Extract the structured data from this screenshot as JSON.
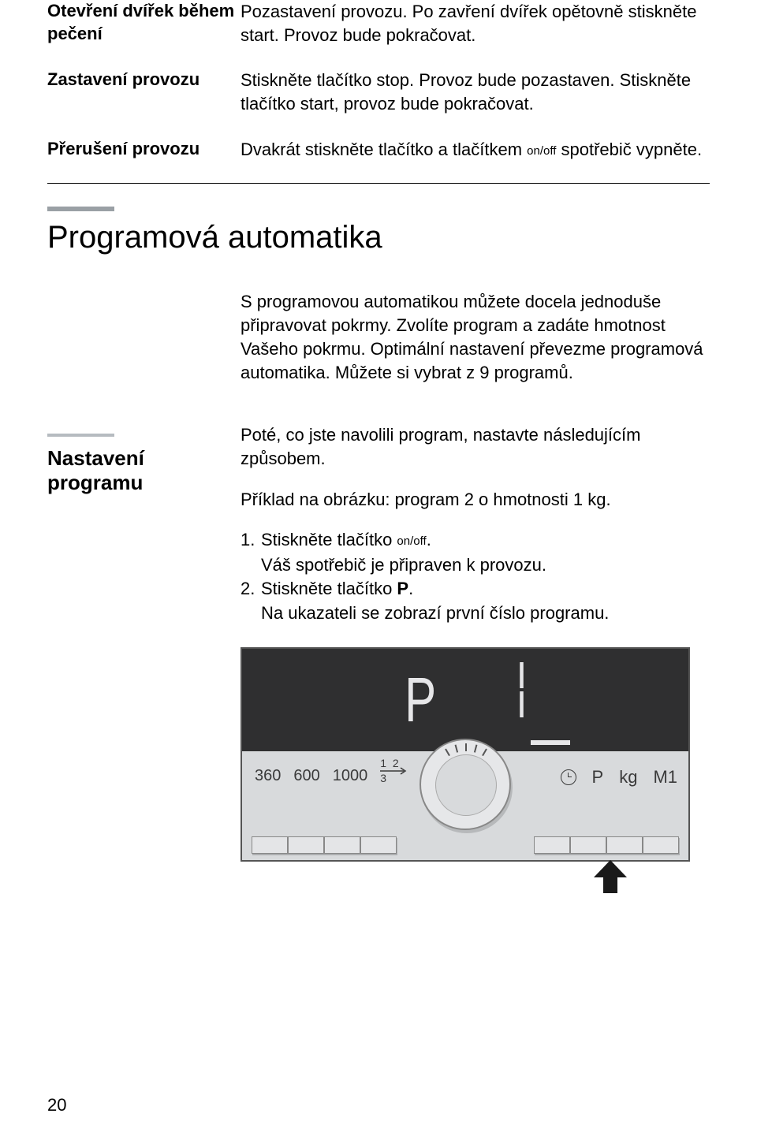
{
  "rows": [
    {
      "label": "Otevření dvířek během pečení",
      "text": "Pozastavení provozu. Po zavření dvířek opětovně stiskněte start. Provoz bude pokračovat."
    },
    {
      "label": "Zastavení provozu",
      "text": "Stiskněte tlačítko stop. Provoz bude pozastaven. Stiskněte tlačítko start, provoz bude pokračovat."
    },
    {
      "label": "Přerušení provozu",
      "text_pre": "Dvakrát stiskněte tlačítko a  tlačítkem ",
      "onoff": "on/off",
      "text_post": " spotřebič vypněte."
    }
  ],
  "section_title": "Programová automatika",
  "intro": "S programovou automatikou můžete docela jednoduše připravovat pokrmy. Zvolíte program a zadáte hmotnost Vašeho pokrmu. Optimální nastavení převezme programová automatika. Můžete si vybrat z 9 programů.",
  "subheading": "Nastavení programu",
  "para2": "Poté, co jste navolili program, nastavte následujícím způsobem.",
  "para3": "Příklad na obrázku: program 2 o hmotnosti 1 kg.",
  "steps": {
    "s1_pre": "Stiskněte tlačítko ",
    "s1_onoff": "on/off",
    "s1_post": ".",
    "s1_sub": "Váš spotřebič je připraven k provozu.",
    "s2_pre": "Stiskněte tlačítko ",
    "s2_bold": "P",
    "s2_post": ".",
    "s2_sub": "Na ukazateli se zobrazí první číslo programu."
  },
  "panel": {
    "display_left": "P",
    "display_right": "1",
    "left_labels": [
      "360",
      "600",
      "1000"
    ],
    "seq": "1 2 3",
    "right_labels": [
      "P",
      "kg",
      "M1"
    ]
  },
  "page_number": "20"
}
